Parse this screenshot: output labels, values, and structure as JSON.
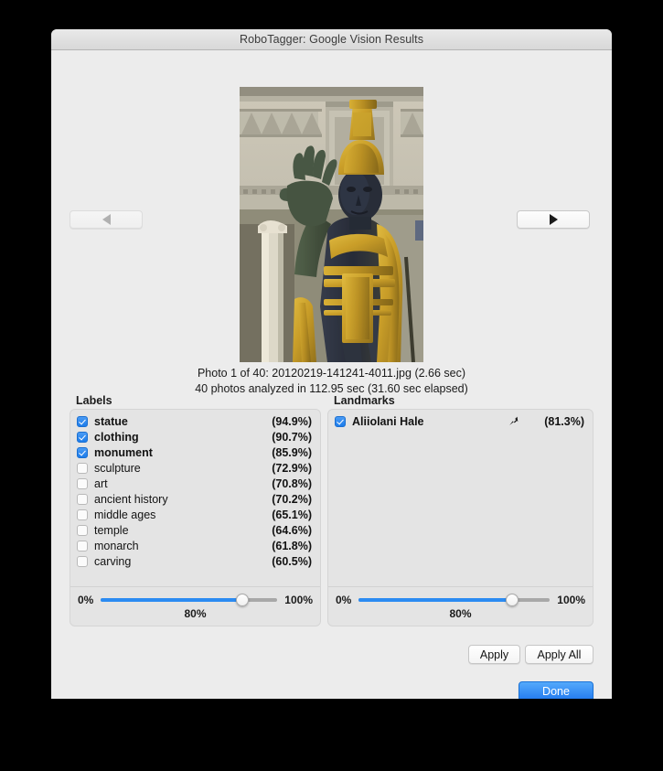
{
  "window": {
    "title": "RoboTagger: Google Vision Results"
  },
  "nav": {
    "prev_icon": "triangle-left-icon",
    "next_icon": "triangle-right-icon"
  },
  "photo": {
    "alt": "King Kamehameha statue in front of Aliiolani Hale"
  },
  "info": {
    "line1": "Photo 1 of 40: 20120219-141241-4011.jpg (2.66 sec)",
    "line2": "40 photos analyzed in 112.95 sec (31.60 sec elapsed)"
  },
  "labels_panel": {
    "title": "Labels",
    "items": [
      {
        "name": "statue",
        "pct": "(94.9%)",
        "checked": true
      },
      {
        "name": "clothing",
        "pct": "(90.7%)",
        "checked": true
      },
      {
        "name": "monument",
        "pct": "(85.9%)",
        "checked": true
      },
      {
        "name": "sculpture",
        "pct": "(72.9%)",
        "checked": false
      },
      {
        "name": "art",
        "pct": "(70.8%)",
        "checked": false
      },
      {
        "name": "ancient history",
        "pct": "(70.2%)",
        "checked": false
      },
      {
        "name": "middle ages",
        "pct": "(65.1%)",
        "checked": false
      },
      {
        "name": "temple",
        "pct": "(64.6%)",
        "checked": false
      },
      {
        "name": "monarch",
        "pct": "(61.8%)",
        "checked": false
      },
      {
        "name": "carving",
        "pct": "(60.5%)",
        "checked": false
      }
    ],
    "slider": {
      "min_label": "0%",
      "max_label": "100%",
      "value_label": "80%",
      "value": 80
    }
  },
  "landmarks_panel": {
    "title": "Landmarks",
    "items": [
      {
        "name": "Aliiolani Hale",
        "pct": "(81.3%)",
        "checked": true,
        "icon": "map-pin-icon"
      }
    ],
    "slider": {
      "min_label": "0%",
      "max_label": "100%",
      "value_label": "80%",
      "value": 80
    }
  },
  "actions": {
    "apply": "Apply",
    "apply_all": "Apply All",
    "done": "Done"
  },
  "colors": {
    "accent": "#2b8bf2",
    "default_button": "#2179ef",
    "window_bg": "#ececec",
    "panel_bg": "#e4e4e4"
  }
}
